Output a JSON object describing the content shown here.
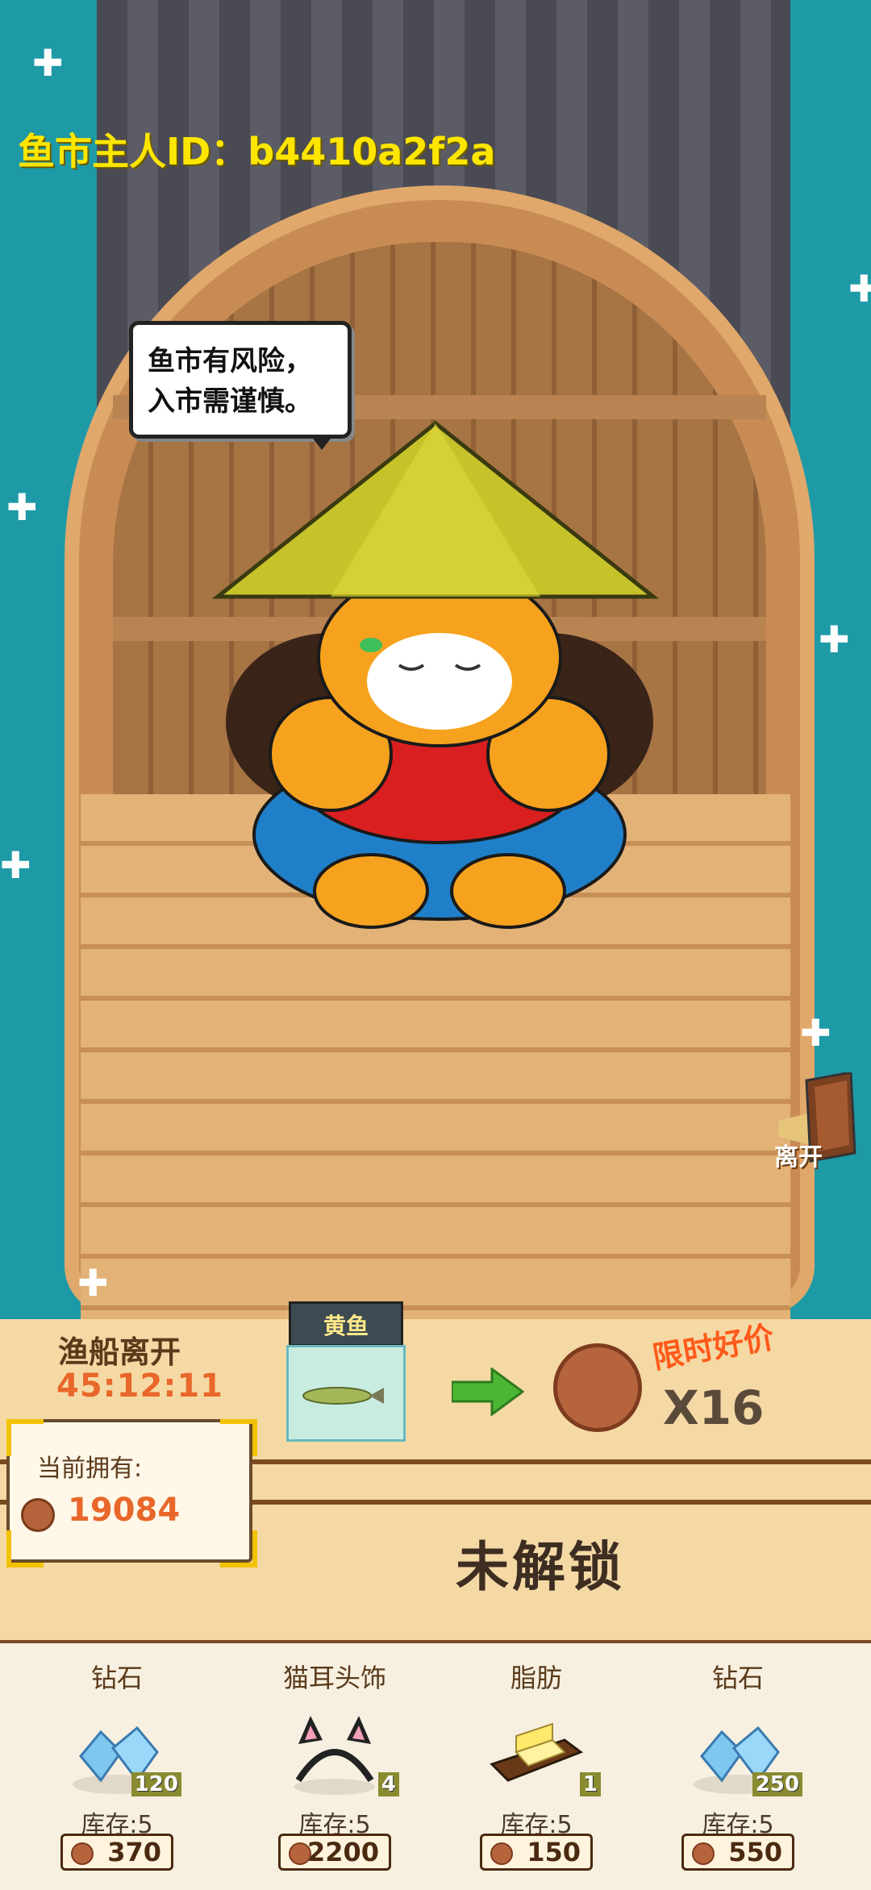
{
  "header": {
    "owner_id": "鱼市主人ID：b4410a2f2a"
  },
  "speech": {
    "line1": "鱼市有风险，",
    "line2": "入市需谨慎。"
  },
  "leave": {
    "label": "离开"
  },
  "trade": {
    "boat_leave_label": "渔船离开",
    "timer": "45:12:11",
    "fish_name": "黄鱼",
    "limited_label": "限时好价",
    "quantity": "X16",
    "locked_label": "未解锁"
  },
  "wallet": {
    "label": "当前拥有:",
    "value": "19084"
  },
  "shop": {
    "items": [
      {
        "name": "钻石",
        "count": "120",
        "stock": "库存:5",
        "price": "370",
        "icon": "diamond-icon"
      },
      {
        "name": "猫耳头饰",
        "count": "4",
        "stock": "库存:5",
        "price": "2200",
        "icon": "cat-ear-headband-icon"
      },
      {
        "name": "脂肪",
        "count": "1",
        "stock": "库存:5",
        "price": "150",
        "icon": "butter-icon"
      },
      {
        "name": "钻石",
        "count": "250",
        "stock": "库存:5",
        "price": "550",
        "icon": "diamond-icon"
      }
    ]
  },
  "colors": {
    "water": "#1e9aa7",
    "wood": "#e2b277",
    "timer": "#e8672a",
    "owner_id": "#ffe600"
  }
}
